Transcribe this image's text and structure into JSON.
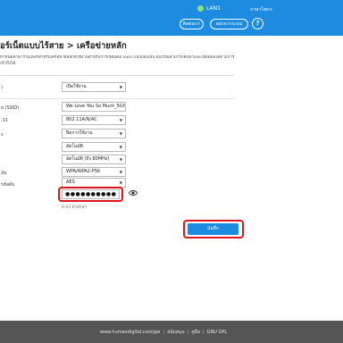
{
  "topbar": {
    "lan_label": "LAN1",
    "language": "ภาษาไทย",
    "contact_button": "ติดต่อเรา",
    "logout_button": "ออกจากระบบ",
    "help_icon": "?"
  },
  "page": {
    "title": "อร์เน็ตแบบไร้สาย > เครือข่ายหลัก",
    "description_line1": "ทำหนดค่าพารามิเตอร์สำหรับเครือข่ายหลักที่ใช้งานสำหรับการเชื่อมต่อ SSID แบบมองเห็น อุปกรณ์สามารถค้นหาและเชื่อมต่อได้ตามการ",
    "description_line2": "เข้าถึงได้"
  },
  "form": {
    "rows": [
      {
        "label": ")",
        "value": "เปิดใช้งาน",
        "type": "select"
      },
      {
        "label": "ย (SSID)",
        "value": "We Love You So Much_5GHz",
        "type": "text"
      },
      {
        "label": ".11",
        "value": "802.11A/N/AC",
        "type": "select"
      },
      {
        "label": "ง",
        "value": "ปิดการใช้งาน",
        "type": "select"
      },
      {
        "label": "",
        "value": "อัตโนมัติ",
        "type": "select"
      },
      {
        "label": "",
        "value": "อัตโนมัติ (ถึง 80MHz)",
        "type": "select"
      },
      {
        "label": "ภัย",
        "value": "WPA/WPA2-PSK",
        "type": "select"
      },
      {
        "label": "รหัสลับ",
        "value": "AES",
        "type": "select"
      }
    ],
    "password_dots": "●●●●●●●●●●",
    "password_hint": "8-63 ตัวอักษร",
    "save_button": "บันทึก"
  },
  "footer": {
    "website": "www.humaxdigital.com/gw",
    "link_privacy": "สนับสนุน",
    "link_manual": "คู่มือ",
    "link_gpl": "GNU GPL"
  },
  "colors": {
    "brand_blue": "#1d8ce0",
    "highlight_red": "#e0141c",
    "footer_gray": "#555555"
  }
}
